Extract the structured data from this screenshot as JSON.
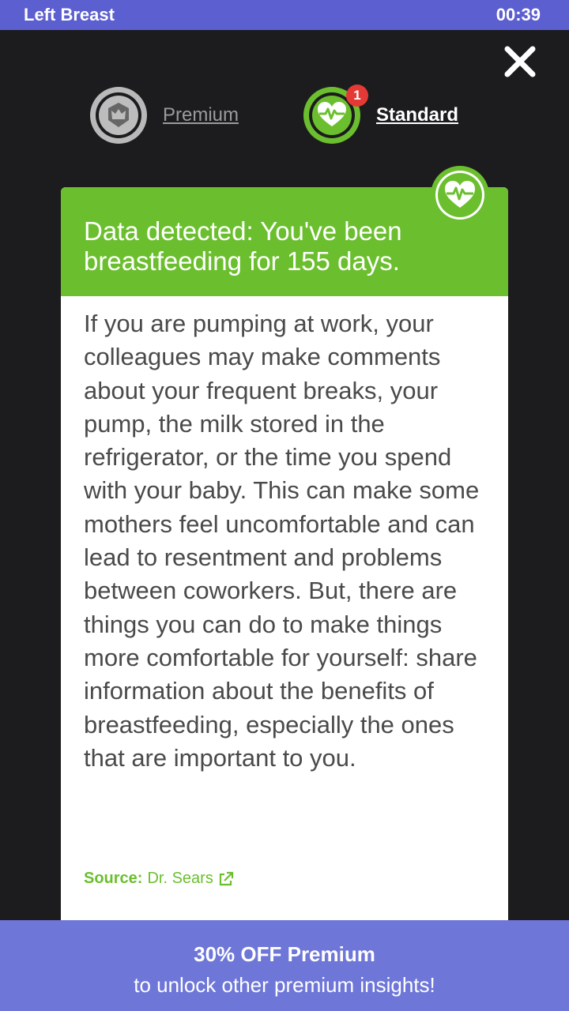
{
  "status_bar": {
    "title": "Left Breast",
    "timer": "00:39",
    "color": "#5c5fcf"
  },
  "close": {
    "icon": "close-icon"
  },
  "tabs": [
    {
      "label": "Premium",
      "icon": "crown-shield-icon",
      "active": false
    },
    {
      "label": "Standard",
      "icon": "heart-pulse-icon",
      "active": true,
      "badge": "1"
    }
  ],
  "card": {
    "header_text": "Data detected: You've been breastfeeding for 155 days.",
    "header_color": "#6bbf2e",
    "icon": "heart-pulse-icon",
    "body_text": "If you are pumping at work, your colleagues may make comments about your frequent breaks, your pump, the milk stored in the refrigerator, or the time you spend with your baby. This can make some mothers feel uncomfortable and can lead to resentment and problems between coworkers. But, there are things you can do to make things more comfortable for yourself: share information about the benefits of breastfeeding, especially the ones that are important to you.",
    "source_label": "Source:",
    "source_name": "Dr. Sears",
    "source_icon": "external-link-icon"
  },
  "promo": {
    "title": "30% OFF Premium",
    "subtitle": "to unlock other premium insights!",
    "color": "#6e76d8"
  }
}
